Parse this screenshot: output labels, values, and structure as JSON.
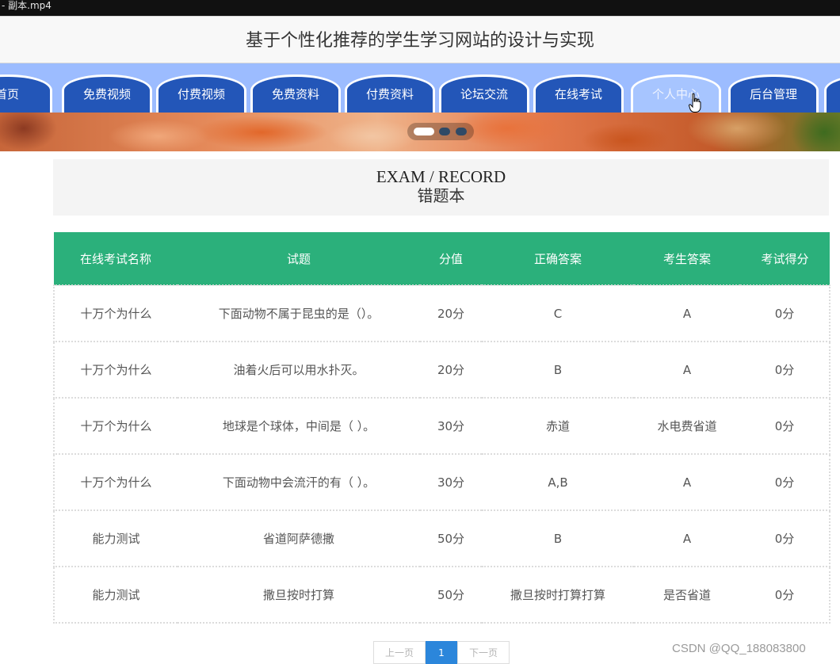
{
  "window": {
    "title": "- 副本.mp4"
  },
  "header": {
    "site_title": "基于个性化推荐的学生学习网站的设计与实现"
  },
  "nav": {
    "items": [
      {
        "label": "首页"
      },
      {
        "label": "免费视频"
      },
      {
        "label": "付费视频"
      },
      {
        "label": "免费资料"
      },
      {
        "label": "付费资料"
      },
      {
        "label": "论坛交流"
      },
      {
        "label": "在线考试"
      },
      {
        "label": "个人中心",
        "active": true
      },
      {
        "label": "后台管理"
      }
    ]
  },
  "banner": {
    "slide_count": 3,
    "active_slide": 1
  },
  "section": {
    "title_en": "EXAM / RECORD",
    "title_cn": "错题本"
  },
  "table": {
    "headers": [
      "在线考试名称",
      "试题",
      "分值",
      "正确答案",
      "考生答案",
      "考试得分"
    ],
    "rows": [
      [
        "十万个为什么",
        "下面动物不属于昆虫的是（）。",
        "20分",
        "C",
        "A",
        "0分"
      ],
      [
        "十万个为什么",
        "油着火后可以用水扑灭。",
        "20分",
        "B",
        "A",
        "0分"
      ],
      [
        "十万个为什么",
        "地球是个球体，中间是（ ）。",
        "30分",
        "赤道",
        "水电费省道",
        "0分"
      ],
      [
        "十万个为什么",
        "下面动物中会流汗的有（ ）。",
        "30分",
        "A,B",
        "A",
        "0分"
      ],
      [
        "能力测试",
        "省道阿萨德撒",
        "50分",
        "B",
        "A",
        "0分"
      ],
      [
        "能力测试",
        "撒旦按时打算",
        "50分",
        "撒旦按时打算打算",
        "是否省道",
        "0分"
      ]
    ]
  },
  "pagination": {
    "prev_label": "上一页",
    "current_page": "1",
    "next_label": "下一页"
  },
  "watermark": {
    "text": "CSDN @QQ_188083800"
  },
  "colors": {
    "nav_tab": "#2356b8",
    "nav_bar": "#9cbcff",
    "table_header": "#2bb07b",
    "page_active": "#2b86db"
  }
}
